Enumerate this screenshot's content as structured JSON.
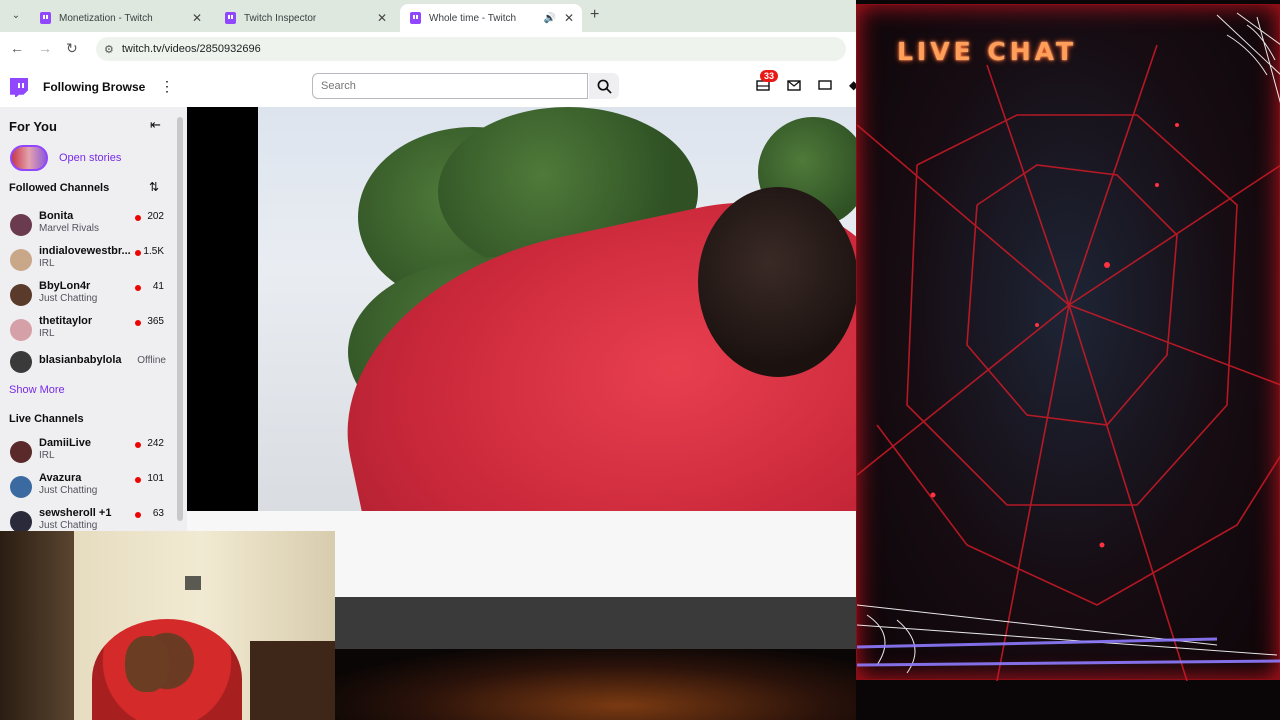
{
  "browser": {
    "tabs": [
      {
        "title": "Monetization - Twitch"
      },
      {
        "title": "Twitch Inspector"
      },
      {
        "title": "Whole time - Twitch",
        "active": true
      }
    ],
    "url": "twitch.tv/videos/2850932696"
  },
  "topnav": {
    "following": "Following",
    "browse": "Browse",
    "search_placeholder": "Search",
    "notifications_count": "33"
  },
  "sidebar": {
    "for_you": "For You",
    "open_stories": "Open stories",
    "followed_header": "Followed Channels",
    "followed": [
      {
        "name": "Bonita",
        "category": "Marvel Rivals",
        "viewers": "202",
        "live": true,
        "avatar_color": "#6a3a4e"
      },
      {
        "name": "indialovewestbr...",
        "category": "IRL",
        "viewers": "1.5K",
        "live": true,
        "avatar_color": "#c9a88a"
      },
      {
        "name": "BbyLon4r",
        "category": "Just Chatting",
        "viewers": "41",
        "live": true,
        "avatar_color": "#5a3a2a"
      },
      {
        "name": "thetitaylor",
        "category": "IRL",
        "viewers": "365",
        "live": true,
        "avatar_color": "#d6a0a8"
      },
      {
        "name": "blasianbabylola",
        "category": "",
        "viewers": "Offline",
        "live": false,
        "avatar_color": "#3a3a3a"
      }
    ],
    "show_more": "Show More",
    "live_header": "Live Channels",
    "live": [
      {
        "name": "DamiiLive",
        "category": "IRL",
        "viewers": "242",
        "avatar_color": "#5a2a2a"
      },
      {
        "name": "Avazura",
        "category": "Just Chatting",
        "viewers": "101",
        "avatar_color": "#3a6aa0"
      },
      {
        "name": "sewsheroll +1",
        "category": "Just Chatting",
        "viewers": "63",
        "avatar_color": "#2a2a3a"
      }
    ]
  },
  "overlay": {
    "chat_title": "LIVE CHAT",
    "accent_color": "#ff9f5a",
    "web_color": "#d01a26"
  }
}
